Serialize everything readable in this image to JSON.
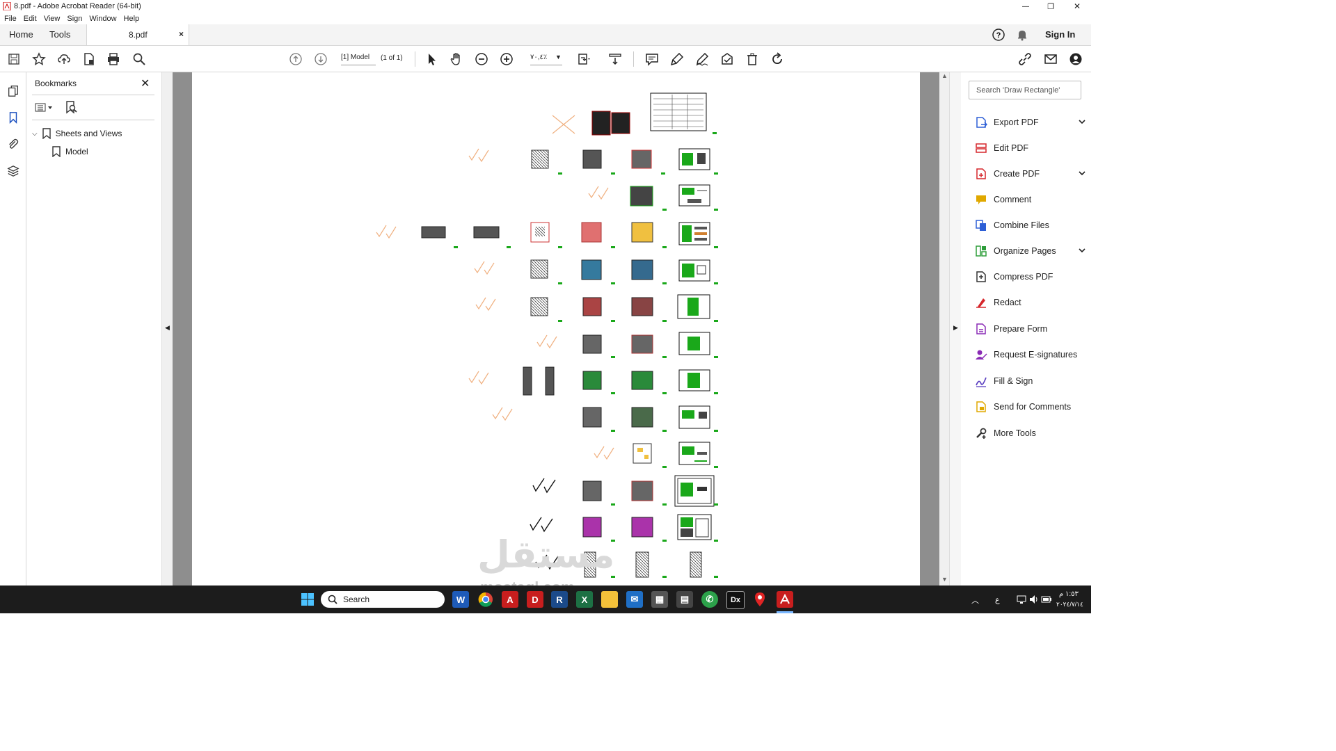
{
  "window": {
    "title": "8.pdf - Adobe Acrobat Reader (64-bit)",
    "minimize": "—",
    "restore": "❐",
    "close": "✕"
  },
  "menu": [
    "File",
    "Edit",
    "View",
    "Sign",
    "Window",
    "Help"
  ],
  "tabs": {
    "home": "Home",
    "tools": "Tools",
    "file": "8.pdf",
    "close_symbol": "×",
    "sign_in": "Sign In"
  },
  "toolbar": {
    "page_field": "[1] Model",
    "page_count": "(1 of 1)",
    "zoom_field": "٧٠,٤٪",
    "icons": [
      "save-icon",
      "star-icon",
      "upload-icon",
      "document-icon",
      "print-icon",
      "find-icon",
      "page-up-icon",
      "page-down-icon",
      "select-cursor-icon",
      "hand-icon",
      "zoom-out-icon",
      "zoom-in-icon",
      "fit-page-icon",
      "scroll-mode-icon",
      "comment-icon",
      "highlight-icon",
      "draw-icon",
      "stamp-icon",
      "delete-icon",
      "rotate-icon"
    ]
  },
  "bookmarks": {
    "header": "Bookmarks",
    "close_symbol": "✕",
    "tree": [
      {
        "label": "Sheets and Views",
        "expanded": true
      },
      {
        "label": "Model",
        "level": 1
      }
    ]
  },
  "tools_pane": {
    "search_placeholder": "Search 'Draw Rectangle'",
    "items": [
      {
        "label": "Export PDF",
        "icon": "export-pdf-icon",
        "color": "#2d5fd6",
        "expandable": true
      },
      {
        "label": "Edit PDF",
        "icon": "edit-pdf-icon",
        "color": "#d6262b",
        "expandable": false
      },
      {
        "label": "Create PDF",
        "icon": "create-pdf-icon",
        "color": "#d6262b",
        "expandable": true
      },
      {
        "label": "Comment",
        "icon": "comment-icon",
        "color": "#e0a800",
        "expandable": false
      },
      {
        "label": "Combine Files",
        "icon": "combine-files-icon",
        "color": "#2d5fd6",
        "expandable": false
      },
      {
        "label": "Organize Pages",
        "icon": "organize-pages-icon",
        "color": "#2e9d3a",
        "expandable": true
      },
      {
        "label": "Compress PDF",
        "icon": "compress-pdf-icon",
        "color": "#333333",
        "expandable": false
      },
      {
        "label": "Redact",
        "icon": "redact-icon",
        "color": "#d6262b",
        "expandable": false
      },
      {
        "label": "Prepare Form",
        "icon": "prepare-form-icon",
        "color": "#8a2bb5",
        "expandable": false
      },
      {
        "label": "Request E-signatures",
        "icon": "request-esign-icon",
        "color": "#8a2bb5",
        "expandable": false
      },
      {
        "label": "Fill & Sign",
        "icon": "fill-sign-icon",
        "color": "#5a3fc0",
        "expandable": false
      },
      {
        "label": "Send for Comments",
        "icon": "send-comments-icon",
        "color": "#e0a800",
        "expandable": false
      },
      {
        "label": "More Tools",
        "icon": "more-tools-icon",
        "color": "#333333",
        "expandable": false
      }
    ]
  },
  "taskbar": {
    "search_label": "Search",
    "apps": [
      "windows-start-icon",
      "word-icon",
      "chrome-icon",
      "autocad-icon",
      "d-app-icon",
      "revit-icon",
      "excel-icon",
      "file-explorer-icon",
      "mail-icon",
      "calculator-icon",
      "notepad-icon",
      "whatsapp-icon",
      "dx-app-icon",
      "maps-icon",
      "acrobat-icon"
    ],
    "app_letters": {
      "autocad": "A",
      "d": "D",
      "revit": "R",
      "excel": "X",
      "dx": "Dx"
    },
    "tray": {
      "lang": "ع",
      "time": "١:٥٣ م",
      "date": "٢٠٢٤/٧/١٤"
    }
  },
  "watermark": {
    "arabic": "مستقل",
    "latin": "mostaql.com"
  }
}
